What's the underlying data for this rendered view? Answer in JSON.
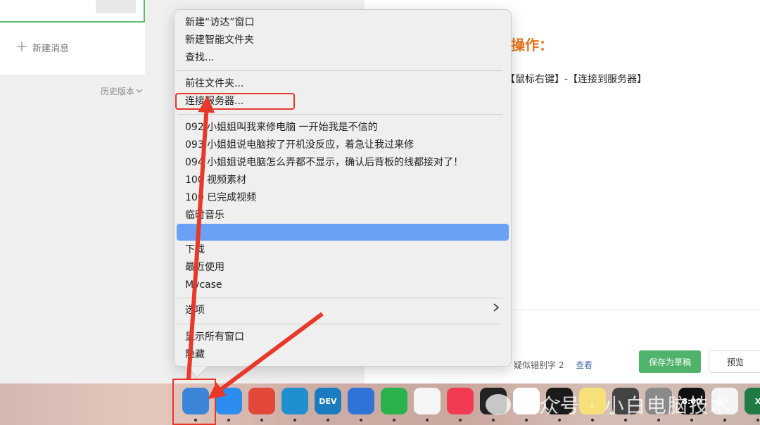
{
  "left_panel": {
    "new_message": "新建消息",
    "history": "历史版本",
    "history_chevron": "chevron-down-icon"
  },
  "article": {
    "heading": "操作：",
    "steps": "【鼠标右键】-【连接到服务器】"
  },
  "bottom_bar": {
    "typo_text": "疑似错别字 2",
    "typo_link": "查看",
    "save_draft": "保存为草稿",
    "preview": "预览"
  },
  "context_menu": {
    "items": [
      "新建“访达”窗口",
      "新建智能文件夹",
      "查找...",
      "前往文件夹...",
      "连接服务器...",
      "092 小姐姐叫我来修电脑 一开始我是不信的",
      "093 小姐姐说电脑按了开机没反应，着急让我过来修",
      "094 小姐姐说电脑怎么弄都不显示，确认后背板的线都接对了！",
      "100 视频素材",
      "100 已完成视频",
      "临时音乐",
      "",
      "下载",
      "最近使用",
      "Mycase",
      "选项",
      "显示所有窗口",
      "隐藏"
    ],
    "submenu_arrow": "chevron-right-icon"
  },
  "dock": {
    "apps": [
      {
        "name": "finder-icon",
        "color": "#3b86d9",
        "label": ""
      },
      {
        "name": "safari-icon",
        "color": "#2d8cf0",
        "label": ""
      },
      {
        "name": "chrome-icon",
        "color": "#e3473a",
        "label": ""
      },
      {
        "name": "edge-icon",
        "color": "#1f8fd0",
        "label": ""
      },
      {
        "name": "edge-dev-icon",
        "color": "#1a7bc0",
        "label": "DEV"
      },
      {
        "name": "windows-app-icon",
        "color": "#2f73d8",
        "label": ""
      },
      {
        "name": "wechat-icon",
        "color": "#2ab24c",
        "label": ""
      },
      {
        "name": "qq-icon",
        "color": "#f5f5f5",
        "label": ""
      },
      {
        "name": "music-icon",
        "color": "#f23a52",
        "label": ""
      },
      {
        "name": "activity-monitor-icon",
        "color": "#222222",
        "label": ""
      },
      {
        "name": "tencent-meeting-icon",
        "color": "#ffffff",
        "label": ""
      },
      {
        "name": "terminal-icon",
        "color": "#1b1b1b",
        "label": ">_"
      },
      {
        "name": "notes-icon",
        "color": "#f7df7a",
        "label": ""
      },
      {
        "name": "calculator-icon",
        "color": "#444444",
        "label": ""
      },
      {
        "name": "system-settings-icon",
        "color": "#8a8a8a",
        "label": ""
      },
      {
        "name": "clock-icon",
        "color": "#111111",
        "label": "8:00"
      },
      {
        "name": "app-store-icon",
        "color": "#f4f4f4",
        "label": ""
      },
      {
        "name": "excel-icon",
        "color": "#1f7a44",
        "label": "X"
      }
    ],
    "watermark": "公众号 · 小白电脑技术"
  }
}
